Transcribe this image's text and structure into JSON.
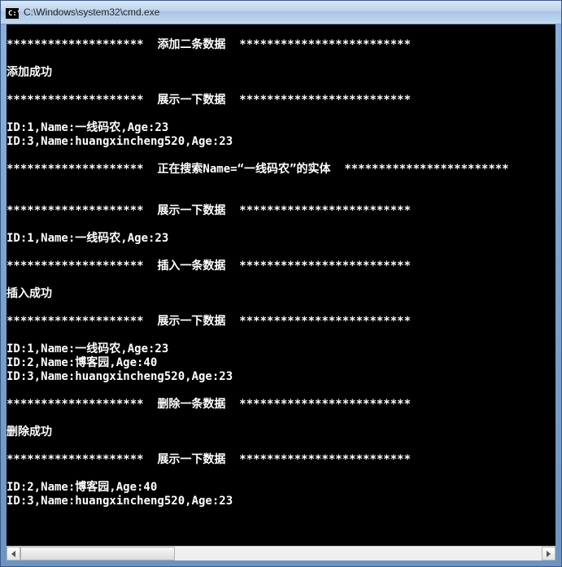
{
  "window": {
    "title": "C:\\Windows\\system32\\cmd.exe",
    "icon": "cmd-icon"
  },
  "stars20": "********************",
  "stars24": "************************",
  "stars25": "*************************",
  "sections": {
    "add_header": "添加二条数据",
    "add_success": "添加成功",
    "show_header": "展示一下数据",
    "search_header": "正在搜索Name=“一线码农”的实体",
    "insert_header": "插入一条数据",
    "insert_success": "插入成功",
    "delete_header": "删除一条数据",
    "delete_success": "删除成功"
  },
  "records": {
    "after_add": [
      "ID:1,Name:一线码农,Age:23",
      "ID:3,Name:huangxincheng520,Age:23"
    ],
    "after_search": [
      "ID:1,Name:一线码农,Age:23"
    ],
    "after_insert": [
      "ID:1,Name:一线码农,Age:23",
      "ID:2,Name:博客园,Age:40",
      "ID:3,Name:huangxincheng520,Age:23"
    ],
    "after_delete": [
      "ID:2,Name:博客园,Age:40",
      "ID:3,Name:huangxincheng520,Age:23"
    ]
  },
  "scrollbar": {
    "thumb_position": "start"
  }
}
